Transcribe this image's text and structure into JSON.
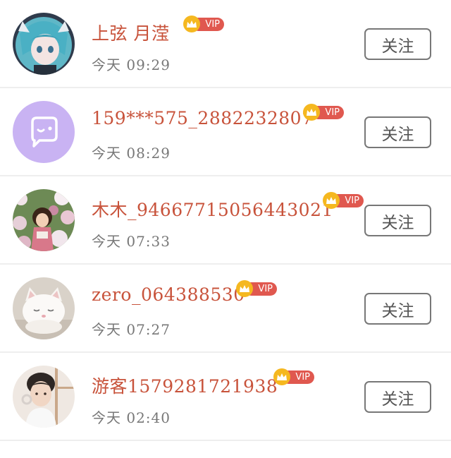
{
  "badge_label": "VIP",
  "users": [
    {
      "name": "上弦 月滢",
      "time": "今天  09:29",
      "follow_label": "关注",
      "avatar_icon": "anime-girl-avatar",
      "has_vip": true
    },
    {
      "name": "159***575_2882232807",
      "time": "今天  08:29",
      "follow_label": "关注",
      "avatar_icon": "default-chat-avatar",
      "has_vip": true
    },
    {
      "name": "木木_94667715056443021",
      "time": "今天  07:33",
      "follow_label": "关注",
      "avatar_icon": "flower-girl-avatar",
      "has_vip": true
    },
    {
      "name": "zero_064388530",
      "time": "今天  07:27",
      "follow_label": "关注",
      "avatar_icon": "white-cat-avatar",
      "has_vip": true
    },
    {
      "name": "游客1579281721938",
      "time": "今天  02:40",
      "follow_label": "关注",
      "avatar_icon": "young-man-avatar",
      "has_vip": true
    }
  ],
  "colors": {
    "name": "#c8533b",
    "time": "#777777",
    "vip_pill": "#e0584f",
    "vip_crown": "#f5b820",
    "divider": "#eeeeee",
    "avatar_purple": "#c9b3f3"
  }
}
